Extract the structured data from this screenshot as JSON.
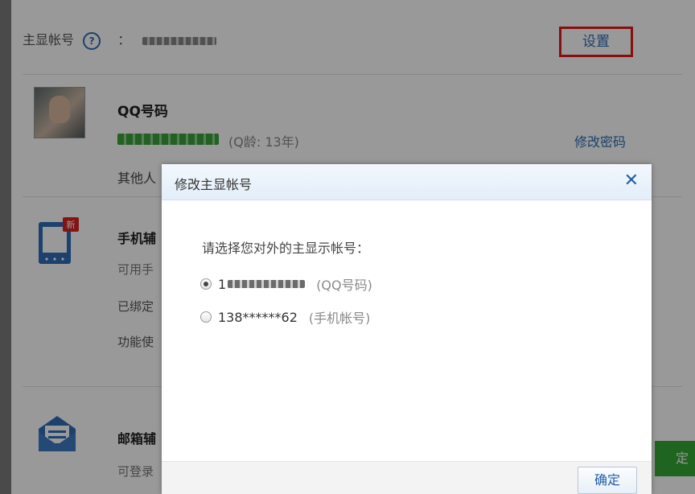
{
  "account": {
    "main_label": "主显帐号",
    "help_icon_char": "?",
    "colon": "：",
    "settings_label": "设置"
  },
  "qq_card": {
    "title": "QQ号码",
    "age": "(Q龄: 13年)",
    "change_password": "修改密码",
    "desc": "其他人"
  },
  "phone_card": {
    "badge": "新",
    "title": "手机辅",
    "line1": "可用手",
    "line2": "已绑定",
    "line3": "功能使"
  },
  "mail_card": {
    "title": "邮箱辅",
    "line1": "可登录"
  },
  "bg_button": {
    "label": "定"
  },
  "dialog": {
    "title": "修改主显帐号",
    "close_char": "✕",
    "prompt": "请选择您对外的主显示帐号：",
    "options": [
      {
        "prefix": "1",
        "value": "",
        "note": "(QQ号码)",
        "checked": true
      },
      {
        "prefix": "",
        "value": "138******62",
        "note": "(手机帐号)",
        "checked": false
      }
    ],
    "ok_label": "确定"
  },
  "colors": {
    "accent": "#2f6db5",
    "highlight_border": "#e11919",
    "qq_green": "#3aa23a"
  }
}
